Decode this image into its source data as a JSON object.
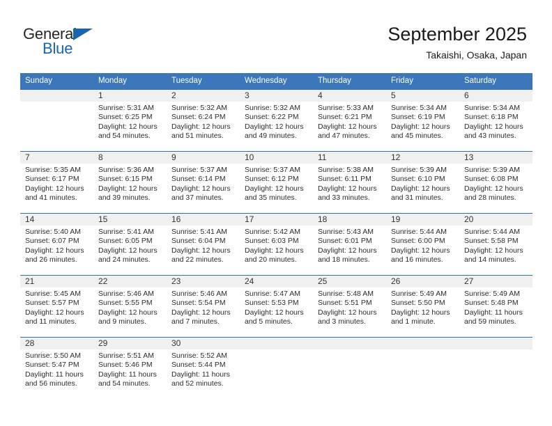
{
  "brand": {
    "name_part1": "General",
    "name_part2": "Blue",
    "accent_color": "#1565b0",
    "triangle_icon": "triangle-icon"
  },
  "header": {
    "title": "September 2025",
    "subtitle": "Takaishi, Osaka, Japan"
  },
  "calendar": {
    "header_bg": "#3b77ba",
    "row_border_color": "#2f6fb0",
    "daynum_band_bg": "#f0f0f0",
    "weekdays": [
      "Sunday",
      "Monday",
      "Tuesday",
      "Wednesday",
      "Thursday",
      "Friday",
      "Saturday"
    ],
    "weeks": [
      [
        {
          "day": "",
          "empty": true
        },
        {
          "day": "1",
          "sunrise": "Sunrise: 5:31 AM",
          "sunset": "Sunset: 6:25 PM",
          "daylight_line1": "Daylight: 12 hours",
          "daylight_line2": "and 54 minutes."
        },
        {
          "day": "2",
          "sunrise": "Sunrise: 5:32 AM",
          "sunset": "Sunset: 6:24 PM",
          "daylight_line1": "Daylight: 12 hours",
          "daylight_line2": "and 51 minutes."
        },
        {
          "day": "3",
          "sunrise": "Sunrise: 5:32 AM",
          "sunset": "Sunset: 6:22 PM",
          "daylight_line1": "Daylight: 12 hours",
          "daylight_line2": "and 49 minutes."
        },
        {
          "day": "4",
          "sunrise": "Sunrise: 5:33 AM",
          "sunset": "Sunset: 6:21 PM",
          "daylight_line1": "Daylight: 12 hours",
          "daylight_line2": "and 47 minutes."
        },
        {
          "day": "5",
          "sunrise": "Sunrise: 5:34 AM",
          "sunset": "Sunset: 6:19 PM",
          "daylight_line1": "Daylight: 12 hours",
          "daylight_line2": "and 45 minutes."
        },
        {
          "day": "6",
          "sunrise": "Sunrise: 5:34 AM",
          "sunset": "Sunset: 6:18 PM",
          "daylight_line1": "Daylight: 12 hours",
          "daylight_line2": "and 43 minutes."
        }
      ],
      [
        {
          "day": "7",
          "sunrise": "Sunrise: 5:35 AM",
          "sunset": "Sunset: 6:17 PM",
          "daylight_line1": "Daylight: 12 hours",
          "daylight_line2": "and 41 minutes."
        },
        {
          "day": "8",
          "sunrise": "Sunrise: 5:36 AM",
          "sunset": "Sunset: 6:15 PM",
          "daylight_line1": "Daylight: 12 hours",
          "daylight_line2": "and 39 minutes."
        },
        {
          "day": "9",
          "sunrise": "Sunrise: 5:37 AM",
          "sunset": "Sunset: 6:14 PM",
          "daylight_line1": "Daylight: 12 hours",
          "daylight_line2": "and 37 minutes."
        },
        {
          "day": "10",
          "sunrise": "Sunrise: 5:37 AM",
          "sunset": "Sunset: 6:12 PM",
          "daylight_line1": "Daylight: 12 hours",
          "daylight_line2": "and 35 minutes."
        },
        {
          "day": "11",
          "sunrise": "Sunrise: 5:38 AM",
          "sunset": "Sunset: 6:11 PM",
          "daylight_line1": "Daylight: 12 hours",
          "daylight_line2": "and 33 minutes."
        },
        {
          "day": "12",
          "sunrise": "Sunrise: 5:39 AM",
          "sunset": "Sunset: 6:10 PM",
          "daylight_line1": "Daylight: 12 hours",
          "daylight_line2": "and 31 minutes."
        },
        {
          "day": "13",
          "sunrise": "Sunrise: 5:39 AM",
          "sunset": "Sunset: 6:08 PM",
          "daylight_line1": "Daylight: 12 hours",
          "daylight_line2": "and 28 minutes."
        }
      ],
      [
        {
          "day": "14",
          "sunrise": "Sunrise: 5:40 AM",
          "sunset": "Sunset: 6:07 PM",
          "daylight_line1": "Daylight: 12 hours",
          "daylight_line2": "and 26 minutes."
        },
        {
          "day": "15",
          "sunrise": "Sunrise: 5:41 AM",
          "sunset": "Sunset: 6:05 PM",
          "daylight_line1": "Daylight: 12 hours",
          "daylight_line2": "and 24 minutes."
        },
        {
          "day": "16",
          "sunrise": "Sunrise: 5:41 AM",
          "sunset": "Sunset: 6:04 PM",
          "daylight_line1": "Daylight: 12 hours",
          "daylight_line2": "and 22 minutes."
        },
        {
          "day": "17",
          "sunrise": "Sunrise: 5:42 AM",
          "sunset": "Sunset: 6:03 PM",
          "daylight_line1": "Daylight: 12 hours",
          "daylight_line2": "and 20 minutes."
        },
        {
          "day": "18",
          "sunrise": "Sunrise: 5:43 AM",
          "sunset": "Sunset: 6:01 PM",
          "daylight_line1": "Daylight: 12 hours",
          "daylight_line2": "and 18 minutes."
        },
        {
          "day": "19",
          "sunrise": "Sunrise: 5:44 AM",
          "sunset": "Sunset: 6:00 PM",
          "daylight_line1": "Daylight: 12 hours",
          "daylight_line2": "and 16 minutes."
        },
        {
          "day": "20",
          "sunrise": "Sunrise: 5:44 AM",
          "sunset": "Sunset: 5:58 PM",
          "daylight_line1": "Daylight: 12 hours",
          "daylight_line2": "and 14 minutes."
        }
      ],
      [
        {
          "day": "21",
          "sunrise": "Sunrise: 5:45 AM",
          "sunset": "Sunset: 5:57 PM",
          "daylight_line1": "Daylight: 12 hours",
          "daylight_line2": "and 11 minutes."
        },
        {
          "day": "22",
          "sunrise": "Sunrise: 5:46 AM",
          "sunset": "Sunset: 5:55 PM",
          "daylight_line1": "Daylight: 12 hours",
          "daylight_line2": "and 9 minutes."
        },
        {
          "day": "23",
          "sunrise": "Sunrise: 5:46 AM",
          "sunset": "Sunset: 5:54 PM",
          "daylight_line1": "Daylight: 12 hours",
          "daylight_line2": "and 7 minutes."
        },
        {
          "day": "24",
          "sunrise": "Sunrise: 5:47 AM",
          "sunset": "Sunset: 5:53 PM",
          "daylight_line1": "Daylight: 12 hours",
          "daylight_line2": "and 5 minutes."
        },
        {
          "day": "25",
          "sunrise": "Sunrise: 5:48 AM",
          "sunset": "Sunset: 5:51 PM",
          "daylight_line1": "Daylight: 12 hours",
          "daylight_line2": "and 3 minutes."
        },
        {
          "day": "26",
          "sunrise": "Sunrise: 5:49 AM",
          "sunset": "Sunset: 5:50 PM",
          "daylight_line1": "Daylight: 12 hours",
          "daylight_line2": "and 1 minute."
        },
        {
          "day": "27",
          "sunrise": "Sunrise: 5:49 AM",
          "sunset": "Sunset: 5:48 PM",
          "daylight_line1": "Daylight: 11 hours",
          "daylight_line2": "and 59 minutes."
        }
      ],
      [
        {
          "day": "28",
          "sunrise": "Sunrise: 5:50 AM",
          "sunset": "Sunset: 5:47 PM",
          "daylight_line1": "Daylight: 11 hours",
          "daylight_line2": "and 56 minutes."
        },
        {
          "day": "29",
          "sunrise": "Sunrise: 5:51 AM",
          "sunset": "Sunset: 5:46 PM",
          "daylight_line1": "Daylight: 11 hours",
          "daylight_line2": "and 54 minutes."
        },
        {
          "day": "30",
          "sunrise": "Sunrise: 5:52 AM",
          "sunset": "Sunset: 5:44 PM",
          "daylight_line1": "Daylight: 11 hours",
          "daylight_line2": "and 52 minutes."
        },
        {
          "day": "",
          "empty": true
        },
        {
          "day": "",
          "empty": true
        },
        {
          "day": "",
          "empty": true
        },
        {
          "day": "",
          "empty": true
        }
      ]
    ]
  }
}
